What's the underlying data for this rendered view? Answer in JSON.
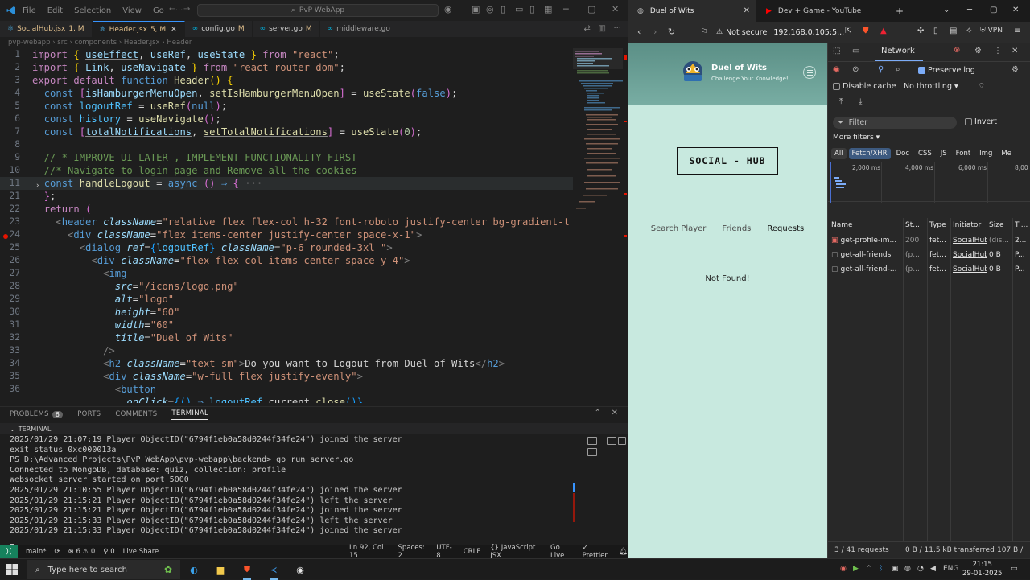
{
  "vscode": {
    "menu": [
      "File",
      "Edit",
      "Selection",
      "View",
      "Go"
    ],
    "search_placeholder": "PvP WebApp",
    "tabs": [
      {
        "name": "SocialHub.jsx",
        "mod": "1, M",
        "active": false
      },
      {
        "name": "Header.jsx",
        "mod": "5, M",
        "active": true
      },
      {
        "name": "config.go",
        "mod": "M",
        "active": false
      },
      {
        "name": "server.go",
        "mod": "M",
        "active": false
      },
      {
        "name": "middleware.go",
        "mod": "",
        "active": false
      }
    ],
    "breadcrumb": [
      "pvp-webapp",
      "src",
      "components",
      "Header.jsx",
      "Header"
    ],
    "code": {
      "l1": {
        "n": "1"
      },
      "l2": {
        "n": "2"
      },
      "l3": {
        "n": "3"
      },
      "l4": {
        "n": "4"
      },
      "l5": {
        "n": "5"
      },
      "l6": {
        "n": "6"
      },
      "l7": {
        "n": "7"
      },
      "l8": {
        "n": "8"
      },
      "l9": {
        "n": "9"
      },
      "l10": {
        "n": "10"
      },
      "l11": {
        "n": "11"
      },
      "l21": {
        "n": "21"
      },
      "l22": {
        "n": "22"
      },
      "l23": {
        "n": "23"
      },
      "l24": {
        "n": "24"
      },
      "l25": {
        "n": "25"
      },
      "l26": {
        "n": "26"
      },
      "l27": {
        "n": "27"
      },
      "l28": {
        "n": "28"
      },
      "l29": {
        "n": "29"
      },
      "l30": {
        "n": "30"
      },
      "l31": {
        "n": "31"
      },
      "l32": {
        "n": "32"
      },
      "l33": {
        "n": "33"
      },
      "l34": {
        "n": "34"
      },
      "l35": {
        "n": "35"
      },
      "l36": {
        "n": "36"
      }
    },
    "panel": {
      "tabs": [
        {
          "label": "PROBLEMS",
          "badge": "6"
        },
        {
          "label": "PORTS",
          "badge": ""
        },
        {
          "label": "COMMENTS",
          "badge": ""
        },
        {
          "label": "TERMINAL",
          "badge": ""
        }
      ],
      "section": "TERMINAL",
      "terminal_lines": [
        "2025/01/29 21:07:19 Player ObjectID(\"6794f1eb0a58d0244f34fe24\") joined the server",
        "exit status 0xc000013a",
        "PS D:\\Advanced Projects\\PvP WebApp\\pvp-webapp\\backend> go run server.go",
        "Connected to MongoDB, database: quiz, collection: profile",
        "Websocket server started on port 5000",
        "2025/01/29 21:10:55 Player ObjectID(\"6794f1eb0a58d0244f34fe24\") joined the server",
        "2025/01/29 21:15:21 Player ObjectID(\"6794f1eb0a58d0244f34fe24\") left the server",
        "2025/01/29 21:15:21 Player ObjectID(\"6794f1eb0a58d0244f34fe24\") joined the server",
        "2025/01/29 21:15:33 Player ObjectID(\"6794f1eb0a58d0244f34fe24\") left the server",
        "2025/01/29 21:15:33 Player ObjectID(\"6794f1eb0a58d0244f34fe24\") joined the server"
      ]
    },
    "status": {
      "branch": "main*",
      "problems": "⊗ 6 ⚠ 0",
      "ports": "⚲ 0",
      "live_share": "Live Share",
      "position": "Ln 92, Col 15",
      "spaces": "Spaces: 2",
      "encoding": "UTF-8",
      "eol": "CRLF",
      "language": "{} JavaScript JSX",
      "golive": "Go Live",
      "prettier": "✓ Prettier"
    }
  },
  "browser": {
    "tabs": [
      {
        "title": "Duel of Wits",
        "active": true
      },
      {
        "title": "Dev + Game - YouTube",
        "active": false
      }
    ],
    "security": "Not secure",
    "url": "192.168.0.105:5...",
    "vpn": "VPN",
    "page": {
      "site_name": "Duel of Wits",
      "tagline": "Challenge Your Knowledge!",
      "hub_title": "SOCIAL - HUB",
      "tabs": [
        "Search Player",
        "Friends",
        "Requests"
      ],
      "active_tab": "Requests",
      "result": "Not Found!"
    }
  },
  "devtools": {
    "panel": "Network",
    "preserve_log": "Preserve log",
    "disable_cache": "Disable cache",
    "throttling": "No throttling",
    "filter_placeholder": "Filter",
    "invert": "Invert",
    "more_filters": "More filters",
    "types": [
      "All",
      "Fetch/XHR",
      "Doc",
      "CSS",
      "JS",
      "Font",
      "Img",
      "Me"
    ],
    "selected_type": "Fetch/XHR",
    "timeline_ticks": [
      "2,000 ms",
      "4,000 ms",
      "6,000 ms",
      "8,00"
    ],
    "columns": [
      "Name",
      "St...",
      "Type",
      "Initiator",
      "Size",
      "Ti..."
    ],
    "rows": [
      {
        "name": "get-profile-im...",
        "status": "200",
        "type": "fet...",
        "initiator": "SocialHub",
        "size": "(dis...",
        "time": "2..."
      },
      {
        "name": "get-all-friends",
        "status": "(p...",
        "type": "fet...",
        "initiator": "SocialHub",
        "size": "0 B",
        "time": "P..."
      },
      {
        "name": "get-all-friend-...",
        "status": "(p...",
        "type": "fet...",
        "initiator": "SocialHub",
        "size": "0 B",
        "time": "P..."
      }
    ],
    "summary_requests": "3 / 41 requests",
    "summary_transferred": "0 B / 11.5 kB transferred",
    "summary_resources": "107 B /"
  },
  "taskbar": {
    "search_placeholder": "Type here to search",
    "lang": "ENG",
    "time": "21:15",
    "date": "29-01-2025"
  },
  "colors": {
    "page_bg": "#c8e9df",
    "header_gradient_start": "#5b8f86",
    "accent_blue": "#3794ff",
    "go_live_green": "#16825d"
  }
}
